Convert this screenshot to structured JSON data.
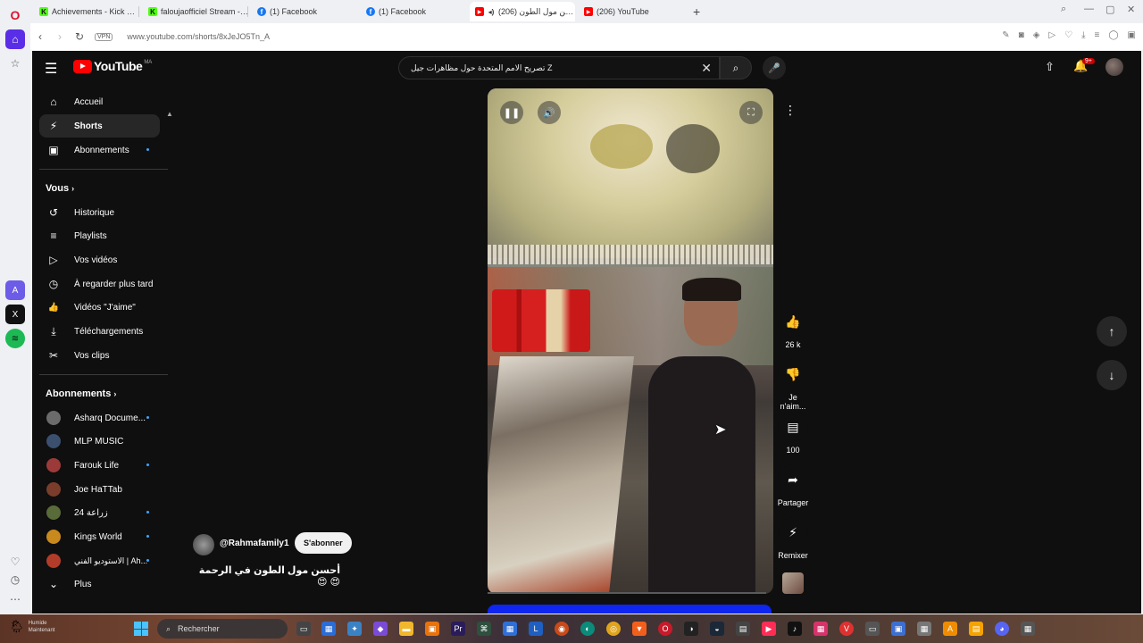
{
  "browser": {
    "tabs": [
      {
        "label": "Achievements - Kick Dash",
        "favicon_color": "#53fc18",
        "fav": "K"
      },
      {
        "label": "faloujaofficiel Stream - Wa",
        "favicon_color": "#53fc18",
        "fav": "K"
      },
      {
        "label": "(1) Facebook",
        "favicon_color": "#1877f2",
        "fav": "f"
      },
      {
        "label": "(1) Facebook",
        "favicon_color": "#1877f2",
        "fav": "f"
      },
      {
        "label": "أحسن مول الطون (206)",
        "favicon_color": "#ff0000",
        "fav": "▶"
      },
      {
        "label": "(206) YouTube",
        "favicon_color": "#ff0000",
        "fav": "▶"
      }
    ],
    "new_tab": "+",
    "vpn": "VPN",
    "url": "www.youtube.com/shorts/8xJeJO5Tn_A"
  },
  "yt": {
    "logo_word": "YouTube",
    "country": "MA",
    "search_query": "تصريح الامم المتحدة حول مظاهرات جيل Z",
    "notif_badge": "9+",
    "nav_main": [
      {
        "label": "Accueil",
        "icon": "home-icon",
        "glyph": "⌂"
      },
      {
        "label": "Shorts",
        "icon": "shorts-icon",
        "glyph": "⚡",
        "active": true
      },
      {
        "label": "Abonnements",
        "icon": "subscriptions-icon",
        "glyph": "▣",
        "dot": true
      }
    ],
    "you_header": "Vous",
    "nav_you": [
      {
        "label": "Historique",
        "icon": "history-icon",
        "glyph": "↺"
      },
      {
        "label": "Playlists",
        "icon": "playlists-icon",
        "glyph": "≡"
      },
      {
        "label": "Vos vidéos",
        "icon": "your-videos-icon",
        "glyph": "▷"
      },
      {
        "label": "À regarder plus tard",
        "icon": "watch-later-icon",
        "glyph": "◷"
      },
      {
        "label": "Vidéos \"J'aime\"",
        "icon": "liked-icon",
        "glyph": "👍"
      },
      {
        "label": "Téléchargements",
        "icon": "download-icon",
        "glyph": "⤓"
      },
      {
        "label": "Vos clips",
        "icon": "clips-icon",
        "glyph": "✂"
      }
    ],
    "subs_header": "Abonnements",
    "subs": [
      {
        "label": "Asharq Docume...",
        "color": "#6b6b6b",
        "dot": true
      },
      {
        "label": "MLP MUSIC",
        "color": "#3b4f6e",
        "dot": false
      },
      {
        "label": "Farouk Life",
        "color": "#9c3a3a",
        "dot": true
      },
      {
        "label": "Joe HaTTab",
        "color": "#7a3d2c",
        "dot": false
      },
      {
        "label": "زراعة 24",
        "color": "#5a6b3a",
        "dot": true
      },
      {
        "label": "Kings World",
        "color": "#c98a1d",
        "dot": true
      },
      {
        "label": "الاستوديو الفني | Ah...",
        "color": "#b23c2a",
        "dot": true
      }
    ],
    "more": "Plus",
    "likes": "26 k",
    "dislike": "Je n'aim...",
    "comments": "100",
    "share": "Partager",
    "remix": "Remixer",
    "channel": "@Rahmafamily1",
    "subscribe": "S'abonner",
    "caption": "أحسن مول الطون في الرحمة 😍 😍"
  },
  "taskbar": {
    "weather_temp": "Humide",
    "weather_sub": "Maintenant",
    "search_placeholder": "Rechercher"
  }
}
